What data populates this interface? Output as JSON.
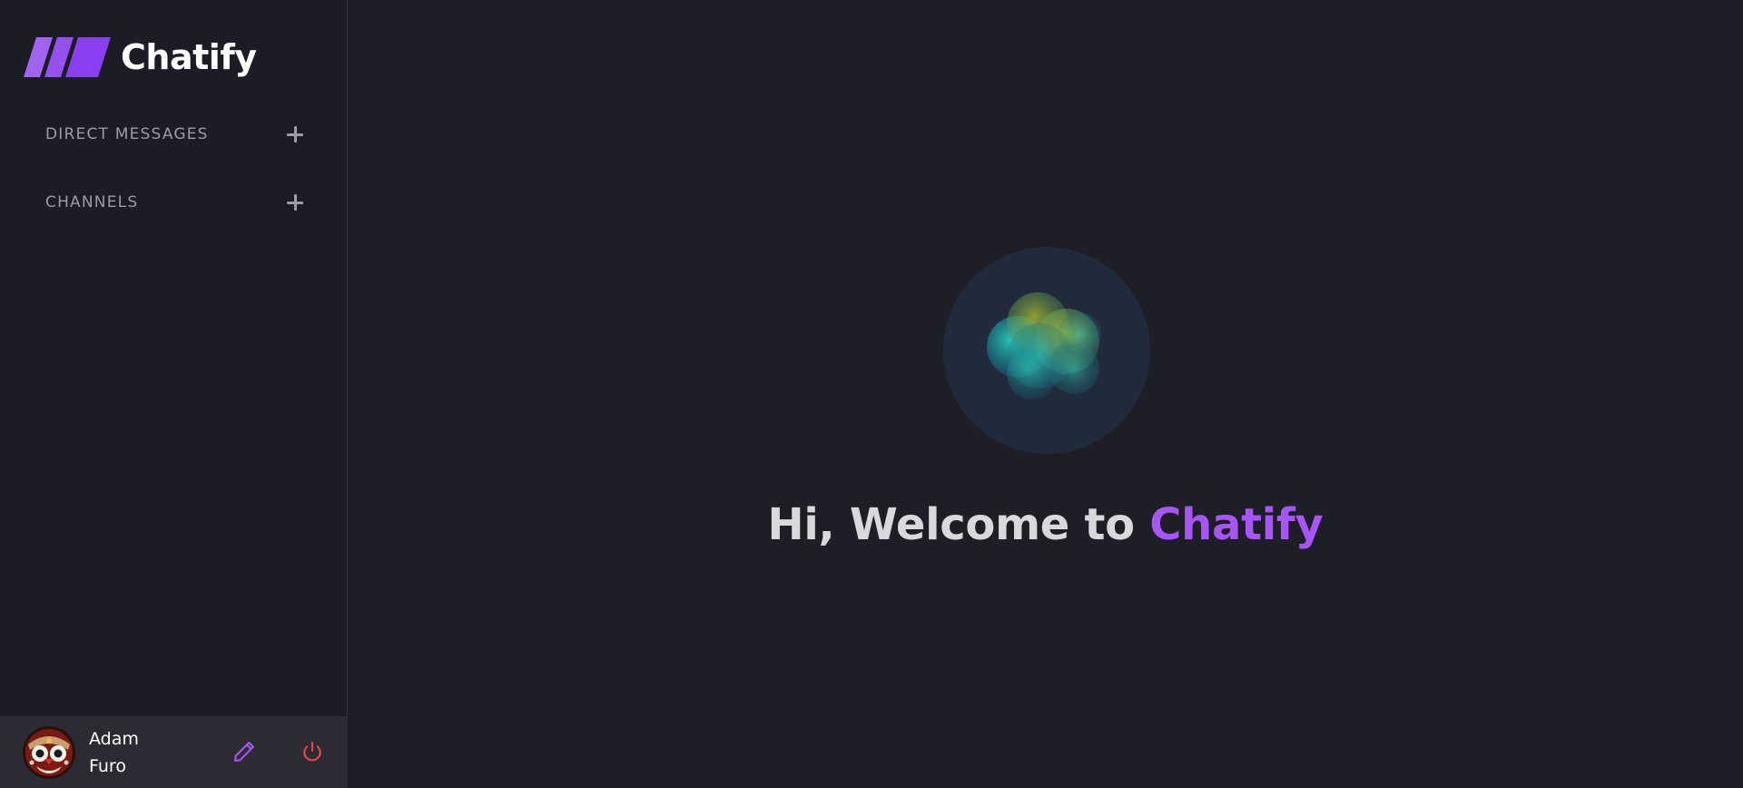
{
  "app": {
    "name": "Chatify"
  },
  "sidebar": {
    "sections": [
      {
        "label": "DIRECT MESSAGES",
        "action_icon": "plus-icon"
      },
      {
        "label": "CHANNELS",
        "action_icon": "plus-icon"
      }
    ]
  },
  "user": {
    "first_name": "Adam",
    "last_name": "Furo",
    "edit_icon": "pencil-icon",
    "logout_icon": "power-icon"
  },
  "main": {
    "welcome_prefix": "Hi, Welcome to ",
    "welcome_brand": "Chatify"
  },
  "colors": {
    "accent": "#a855f7",
    "danger": "#ef4444",
    "sidebar_bg": "#1b1c24",
    "main_bg": "#1d1e26",
    "user_bar_bg": "#2a2b33"
  }
}
